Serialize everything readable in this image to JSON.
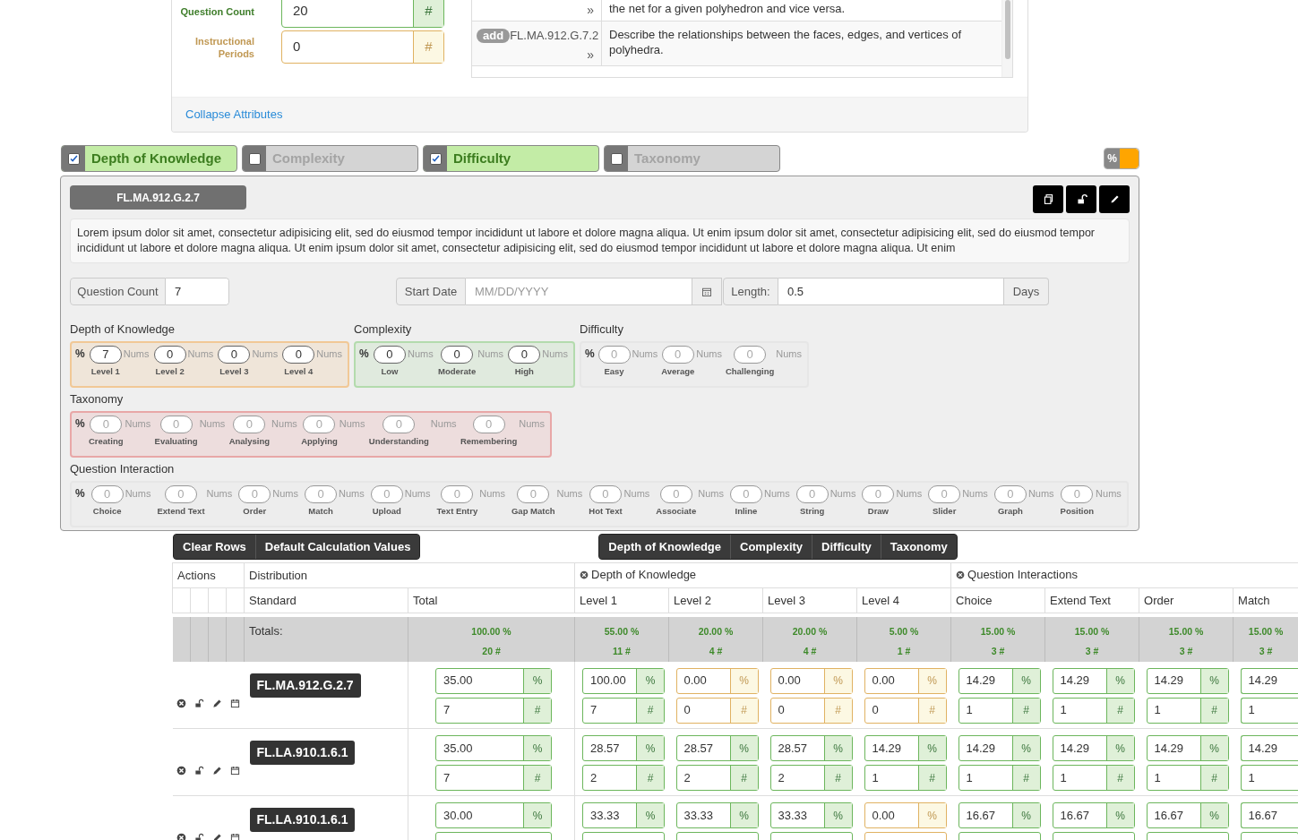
{
  "attributes_card": {
    "fields": [
      {
        "label": "Question Count",
        "value": "20",
        "addon": "#",
        "warning": false
      },
      {
        "label": "Instructional Periods",
        "value": "0",
        "addon": "#",
        "warning": true
      }
    ],
    "standards": [
      {
        "chevron": "»",
        "description": "the net for a given polyhedron and vice versa."
      },
      {
        "badge": "add",
        "code": "FL.MA.912.G.7.2",
        "chevron": "»",
        "description": "Describe the relationships between the faces, edges, and vertices of polyhedra."
      }
    ],
    "collapse_link": "Collapse Attributes"
  },
  "category_toggles": [
    {
      "label": "Depth of Knowledge",
      "checked": true
    },
    {
      "label": "Complexity",
      "checked": false
    },
    {
      "label": "Difficulty",
      "checked": true
    },
    {
      "label": "Taxonomy",
      "checked": false
    }
  ],
  "percent_switch": {
    "label": "%",
    "on": true
  },
  "standard_panel": {
    "standard": "FL.MA.912.G.2.7",
    "description": "Lorem ipsum dolor sit amet, consectetur adipisicing elit, sed do eiusmod tempor incididunt ut labore et dolore magna aliqua. Ut enim ipsum dolor sit amet, consectetur adipisicing elit, sed do eiusmod tempor incididunt ut labore et dolore magna aliqua. Ut enim ipsum dolor sit amet, consectetur adipisicing elit, sed do eiusmod tempor incididunt ut labore et dolore magna aliqua. Ut enim",
    "question_count": {
      "label": "Question Count",
      "value": "7"
    },
    "start_date": {
      "label": "Start Date",
      "placeholder": "MM/DD/YYYY"
    },
    "length": {
      "label": "Length:",
      "value": "0.5",
      "unit": "Days"
    },
    "groups": [
      {
        "title": "Depth of Knowledge",
        "color": "#f1c896",
        "disabled": false,
        "percent": "%",
        "items": [
          {
            "label": "Level 1",
            "value": "7",
            "unit": "Nums"
          },
          {
            "label": "Level 2",
            "value": "0",
            "unit": "Nums"
          },
          {
            "label": "Level 3",
            "value": "0",
            "unit": "Nums"
          },
          {
            "label": "Level 4",
            "value": "0",
            "unit": "Nums"
          }
        ]
      },
      {
        "title": "Complexity",
        "color": "#b3dbad",
        "disabled": false,
        "percent": "%",
        "items": [
          {
            "label": "Low",
            "value": "0",
            "unit": "Nums"
          },
          {
            "label": "Moderate",
            "value": "0",
            "unit": "Nums"
          },
          {
            "label": "High",
            "value": "0",
            "unit": "Nums"
          }
        ]
      },
      {
        "title": "Difficulty",
        "color": "#e6e6e6",
        "disabled": true,
        "percent": "%",
        "items": [
          {
            "label": "Easy",
            "value": "0",
            "unit": "Nums"
          },
          {
            "label": "Average",
            "value": "0",
            "unit": "Nums"
          },
          {
            "label": "Challenging",
            "value": "0",
            "unit": "Nums"
          }
        ]
      },
      {
        "title": "Taxonomy",
        "color": "#e8a7a7",
        "disabled": true,
        "percent": "%",
        "items": [
          {
            "label": "Creating",
            "value": "0",
            "unit": "Nums"
          },
          {
            "label": "Evaluating",
            "value": "0",
            "unit": "Nums"
          },
          {
            "label": "Analysing",
            "value": "0",
            "unit": "Nums"
          },
          {
            "label": "Applying",
            "value": "0",
            "unit": "Nums"
          },
          {
            "label": "Understanding",
            "value": "0",
            "unit": "Nums"
          },
          {
            "label": "Remembering",
            "value": "0",
            "unit": "Nums"
          }
        ]
      },
      {
        "title": "Question Interaction",
        "color": "#e6e6e6",
        "disabled": true,
        "percent": "%",
        "items": [
          {
            "label": "Choice",
            "value": "0",
            "unit": "Nums"
          },
          {
            "label": "Extend Text",
            "value": "0",
            "unit": "Nums"
          },
          {
            "label": "Order",
            "value": "0",
            "unit": "Nums"
          },
          {
            "label": "Match",
            "value": "0",
            "unit": "Nums"
          },
          {
            "label": "Upload",
            "value": "0",
            "unit": "Nums"
          },
          {
            "label": "Text Entry",
            "value": "0",
            "unit": "Nums"
          },
          {
            "label": "Gap Match",
            "value": "0",
            "unit": "Nums"
          },
          {
            "label": "Hot Text",
            "value": "0",
            "unit": "Nums"
          },
          {
            "label": "Associate",
            "value": "0",
            "unit": "Nums"
          },
          {
            "label": "Inline",
            "value": "0",
            "unit": "Nums"
          },
          {
            "label": "String",
            "value": "0",
            "unit": "Nums"
          },
          {
            "label": "Draw",
            "value": "0",
            "unit": "Nums"
          },
          {
            "label": "Slider",
            "value": "0",
            "unit": "Nums"
          },
          {
            "label": "Graph",
            "value": "0",
            "unit": "Nums"
          },
          {
            "label": "Position",
            "value": "0",
            "unit": "Nums"
          }
        ]
      }
    ]
  },
  "action_buttons": [
    "Clear Rows",
    "Default Calculation Values"
  ],
  "category_buttons": [
    "Depth of Knowledge",
    "Complexity",
    "Difficulty",
    "Taxonomy"
  ],
  "table": {
    "pct_addon": "%",
    "count_addon": "#",
    "header_groups": [
      {
        "label": "Actions",
        "kind": "actions",
        "removable": false
      },
      {
        "label": "Distribution",
        "removable": false,
        "columns": [
          {
            "label": "Standard",
            "kind": "standard"
          },
          {
            "label": "Total",
            "kind": "wide"
          }
        ]
      },
      {
        "label": "Depth of Knowledge",
        "removable": true,
        "columns": [
          {
            "label": "Level 1",
            "kind": "narrow"
          },
          {
            "label": "Level 2",
            "kind": "narrow"
          },
          {
            "label": "Level 3",
            "kind": "narrow"
          },
          {
            "label": "Level 4",
            "kind": "narrow"
          }
        ]
      },
      {
        "label": "Question Interactions",
        "removable": true,
        "columns": [
          {
            "label": "Choice",
            "kind": "narrow"
          },
          {
            "label": "Extend Text",
            "kind": "narrow"
          },
          {
            "label": "Order",
            "kind": "narrow"
          },
          {
            "label": "Match",
            "kind": "clipped"
          }
        ]
      }
    ],
    "totals": [
      {
        "kind": "label",
        "text": "Totals:"
      },
      {
        "kind": "value",
        "pct": "100.00 %",
        "count": "20 #"
      },
      {
        "kind": "value",
        "pct": "55.00 %",
        "count": "11 #"
      },
      {
        "kind": "value",
        "pct": "20.00 %",
        "count": "4 #"
      },
      {
        "kind": "value",
        "pct": "20.00 %",
        "count": "4 #"
      },
      {
        "kind": "value",
        "pct": "5.00 %",
        "count": "1 #"
      },
      {
        "kind": "value",
        "pct": "15.00 %",
        "count": "3 #"
      },
      {
        "kind": "value",
        "pct": "15.00 %",
        "count": "3 #"
      },
      {
        "kind": "value",
        "pct": "15.00 %",
        "count": "3 #"
      },
      {
        "kind": "value",
        "pct": "15.00 %",
        "count": "3 #"
      }
    ],
    "rows": [
      {
        "cells": [
          {
            "kind": "standard",
            "text": "FL.MA.912.G.2.7"
          },
          {
            "kind": "input",
            "pct": "35.00",
            "count": "7",
            "warning": false
          },
          {
            "kind": "input",
            "pct": "100.00",
            "count": "7",
            "warning": false
          },
          {
            "kind": "input",
            "pct": "0.00",
            "count": "0",
            "warning": true
          },
          {
            "kind": "input",
            "pct": "0.00",
            "count": "0",
            "warning": true
          },
          {
            "kind": "input",
            "pct": "0.00",
            "count": "0",
            "warning": true
          },
          {
            "kind": "input",
            "pct": "14.29",
            "count": "1",
            "warning": false
          },
          {
            "kind": "input",
            "pct": "14.29",
            "count": "1",
            "warning": false
          },
          {
            "kind": "input",
            "pct": "14.29",
            "count": "1",
            "warning": false
          },
          {
            "kind": "input",
            "pct": "14.29",
            "count": "1",
            "warning": false
          }
        ]
      },
      {
        "cells": [
          {
            "kind": "standard",
            "text": "FL.LA.910.1.6.1"
          },
          {
            "kind": "input",
            "pct": "35.00",
            "count": "7",
            "warning": false
          },
          {
            "kind": "input",
            "pct": "28.57",
            "count": "2",
            "warning": false
          },
          {
            "kind": "input",
            "pct": "28.57",
            "count": "2",
            "warning": false
          },
          {
            "kind": "input",
            "pct": "28.57",
            "count": "2",
            "warning": false
          },
          {
            "kind": "input",
            "pct": "14.29",
            "count": "1",
            "warning": false
          },
          {
            "kind": "input",
            "pct": "14.29",
            "count": "1",
            "warning": false
          },
          {
            "kind": "input",
            "pct": "14.29",
            "count": "1",
            "warning": false
          },
          {
            "kind": "input",
            "pct": "14.29",
            "count": "1",
            "warning": false
          },
          {
            "kind": "input",
            "pct": "14.29",
            "count": "1",
            "warning": false
          }
        ]
      },
      {
        "cells": [
          {
            "kind": "standard",
            "text": "FL.LA.910.1.6.1"
          },
          {
            "kind": "input",
            "pct": "30.00",
            "warning": false
          },
          {
            "kind": "input",
            "pct": "33.33",
            "warning": false
          },
          {
            "kind": "input",
            "pct": "33.33",
            "warning": false
          },
          {
            "kind": "input",
            "pct": "33.33",
            "warning": false
          },
          {
            "kind": "input",
            "pct": "0.00",
            "warning": true
          },
          {
            "kind": "input",
            "pct": "16.67",
            "warning": false
          },
          {
            "kind": "input",
            "pct": "16.67",
            "warning": false
          },
          {
            "kind": "input",
            "pct": "16.67",
            "warning": false
          },
          {
            "kind": "input",
            "pct": "16.67",
            "warning": false
          }
        ]
      }
    ]
  }
}
